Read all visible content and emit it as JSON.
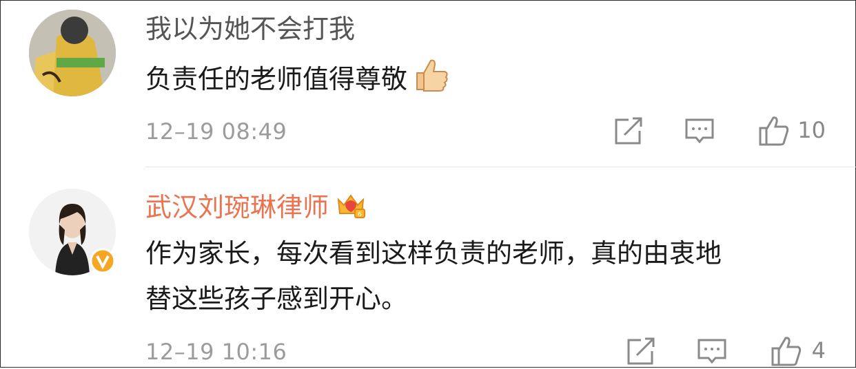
{
  "comments": [
    {
      "name": "我以为她不会打我",
      "text": "负责任的老师值得尊敬",
      "emoji": "thumbs-up-emoji",
      "time": "12–19 08:49",
      "likes": "10"
    },
    {
      "name": "武汉刘琬琳律师",
      "badge": "vip-crown-icon",
      "verified": "verified-v-badge",
      "text_line1": "作为家长，每次看到这样负责的老师，真的由衷地",
      "text_line2": "替这些孩子感到开心。",
      "time": "12–19 10:16",
      "likes": "4"
    }
  ],
  "colors": {
    "vip_name": "#eb7350",
    "meta": "#9b9b9b",
    "icon": "#8a8a8a",
    "verified": "#f5a623"
  }
}
